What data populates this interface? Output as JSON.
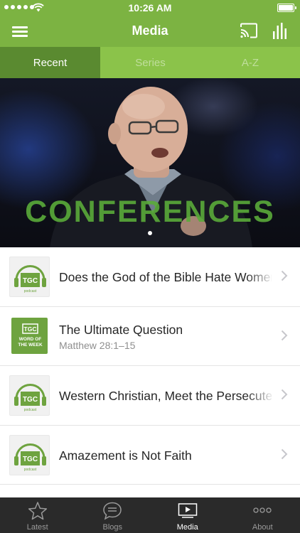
{
  "status_bar": {
    "time": "10:26 AM"
  },
  "nav": {
    "title": "Media",
    "menu_icon": "hamburger-menu-icon",
    "cast_icon": "cast-icon",
    "stats_icon": "bar-chart-icon"
  },
  "tabs": [
    {
      "label": "Recent",
      "active": true
    },
    {
      "label": "Series",
      "active": false
    },
    {
      "label": "A-Z",
      "active": false
    }
  ],
  "hero": {
    "title": "CONFERENCES",
    "slide_count": 1,
    "current_slide": 1
  },
  "items": [
    {
      "title": "Does the God of the Bible Hate Women?",
      "subtitle": "",
      "thumb_text": "TGC",
      "thumb_sub": "podcast",
      "thumb_type": "podcast"
    },
    {
      "title": "The Ultimate Question",
      "subtitle": "Matthew 28:1–15",
      "thumb_text": "TGC",
      "thumb_sub": "WORD OF THE WEEK",
      "thumb_type": "word-of-the-week"
    },
    {
      "title": "Western Christian, Meet the Persecuted",
      "subtitle": "",
      "thumb_text": "TGC",
      "thumb_sub": "podcast",
      "thumb_type": "podcast"
    },
    {
      "title": "Amazement is Not Faith",
      "subtitle": "",
      "thumb_text": "TGC",
      "thumb_sub": "podcast",
      "thumb_type": "podcast"
    }
  ],
  "tab_bar": [
    {
      "label": "Latest",
      "icon": "star-icon",
      "active": false
    },
    {
      "label": "Blogs",
      "icon": "chat-bubble-icon",
      "active": false
    },
    {
      "label": "Media",
      "icon": "play-screen-icon",
      "active": true
    },
    {
      "label": "About",
      "icon": "ellipsis-icon",
      "active": false
    }
  ],
  "colors": {
    "brand_green": "#7cb342",
    "active_tab": "#5a8a30",
    "tab_bar_bg": "#2a2a2a"
  }
}
